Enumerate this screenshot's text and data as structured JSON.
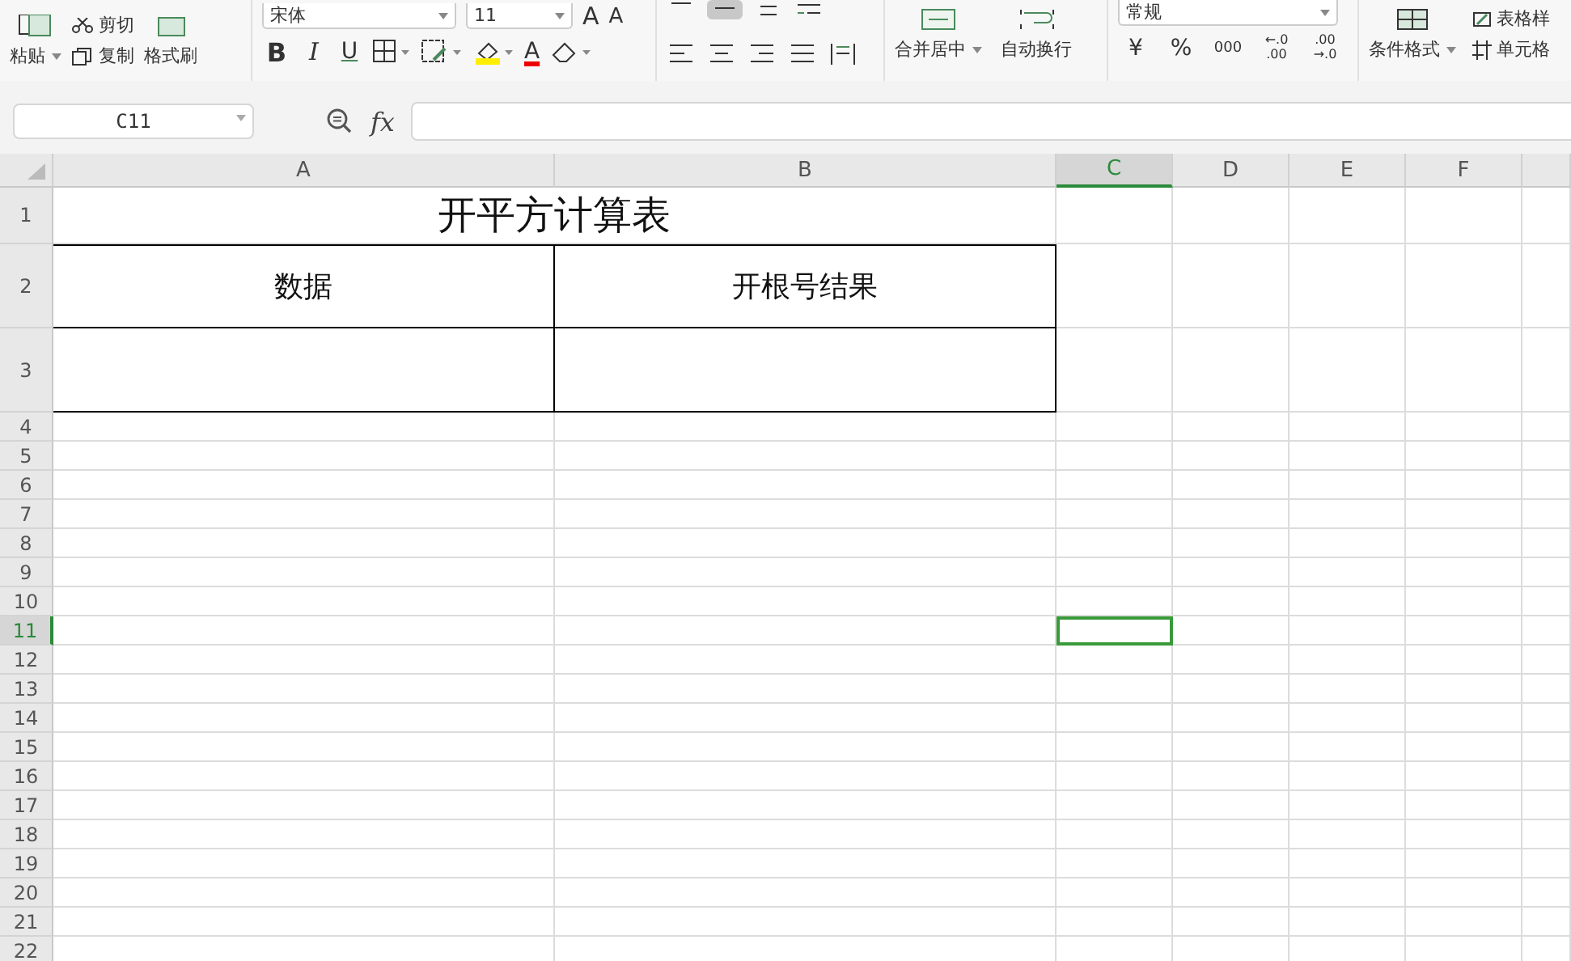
{
  "ribbon": {
    "clipboard": {
      "paste": "粘贴",
      "cut": "剪切",
      "copy": "复制",
      "format_painter": "格式刷"
    },
    "font": {
      "name": "宋体",
      "size": "11",
      "grow": "A",
      "shrink": "A",
      "bold": "B",
      "italic": "I",
      "underline": "U",
      "font_color_letter": "A"
    },
    "alignment": {
      "merge": "合并居中",
      "wrap": "自动换行"
    },
    "number": {
      "format": "常规",
      "currency": "¥",
      "percent": "%",
      "thousands": "000",
      "inc_decimal_top": "←.0",
      "inc_decimal_bottom": ".00",
      "dec_decimal_top": ".00",
      "dec_decimal_bottom": "→.0"
    },
    "styles": {
      "conditional": "条件格式",
      "table_style": "表格样",
      "cell_style": "单元格"
    }
  },
  "formula_bar": {
    "name_box": "C11",
    "fx": "fx"
  },
  "columns": [
    {
      "label": "A",
      "selected": false
    },
    {
      "label": "B",
      "selected": false
    },
    {
      "label": "C",
      "selected": true
    },
    {
      "label": "D",
      "selected": false
    },
    {
      "label": "E",
      "selected": false
    },
    {
      "label": "F",
      "selected": false
    }
  ],
  "rows": [
    {
      "label": "1",
      "kind": "title",
      "selected": false,
      "cells": [
        "开平方计算表"
      ]
    },
    {
      "label": "2",
      "kind": "table",
      "selected": false,
      "cells": [
        "数据",
        "开根号结果"
      ]
    },
    {
      "label": "3",
      "kind": "table",
      "selected": false,
      "cells": [
        "",
        ""
      ]
    },
    {
      "label": "4",
      "kind": "blank",
      "selected": false
    },
    {
      "label": "5",
      "kind": "blank",
      "selected": false
    },
    {
      "label": "6",
      "kind": "blank",
      "selected": false
    },
    {
      "label": "7",
      "kind": "blank",
      "selected": false
    },
    {
      "label": "8",
      "kind": "blank",
      "selected": false
    },
    {
      "label": "9",
      "kind": "blank",
      "selected": false
    },
    {
      "label": "10",
      "kind": "blank",
      "selected": false
    },
    {
      "label": "11",
      "kind": "blank",
      "selected": true
    },
    {
      "label": "12",
      "kind": "blank",
      "selected": false
    },
    {
      "label": "13",
      "kind": "blank",
      "selected": false
    },
    {
      "label": "14",
      "kind": "blank",
      "selected": false
    },
    {
      "label": "15",
      "kind": "blank",
      "selected": false
    },
    {
      "label": "16",
      "kind": "blank",
      "selected": false
    },
    {
      "label": "17",
      "kind": "blank",
      "selected": false
    },
    {
      "label": "18",
      "kind": "blank",
      "selected": false
    },
    {
      "label": "19",
      "kind": "blank",
      "selected": false
    },
    {
      "label": "20",
      "kind": "blank",
      "selected": false
    },
    {
      "label": "21",
      "kind": "blank",
      "selected": false
    },
    {
      "label": "22",
      "kind": "blank",
      "selected": false
    }
  ]
}
